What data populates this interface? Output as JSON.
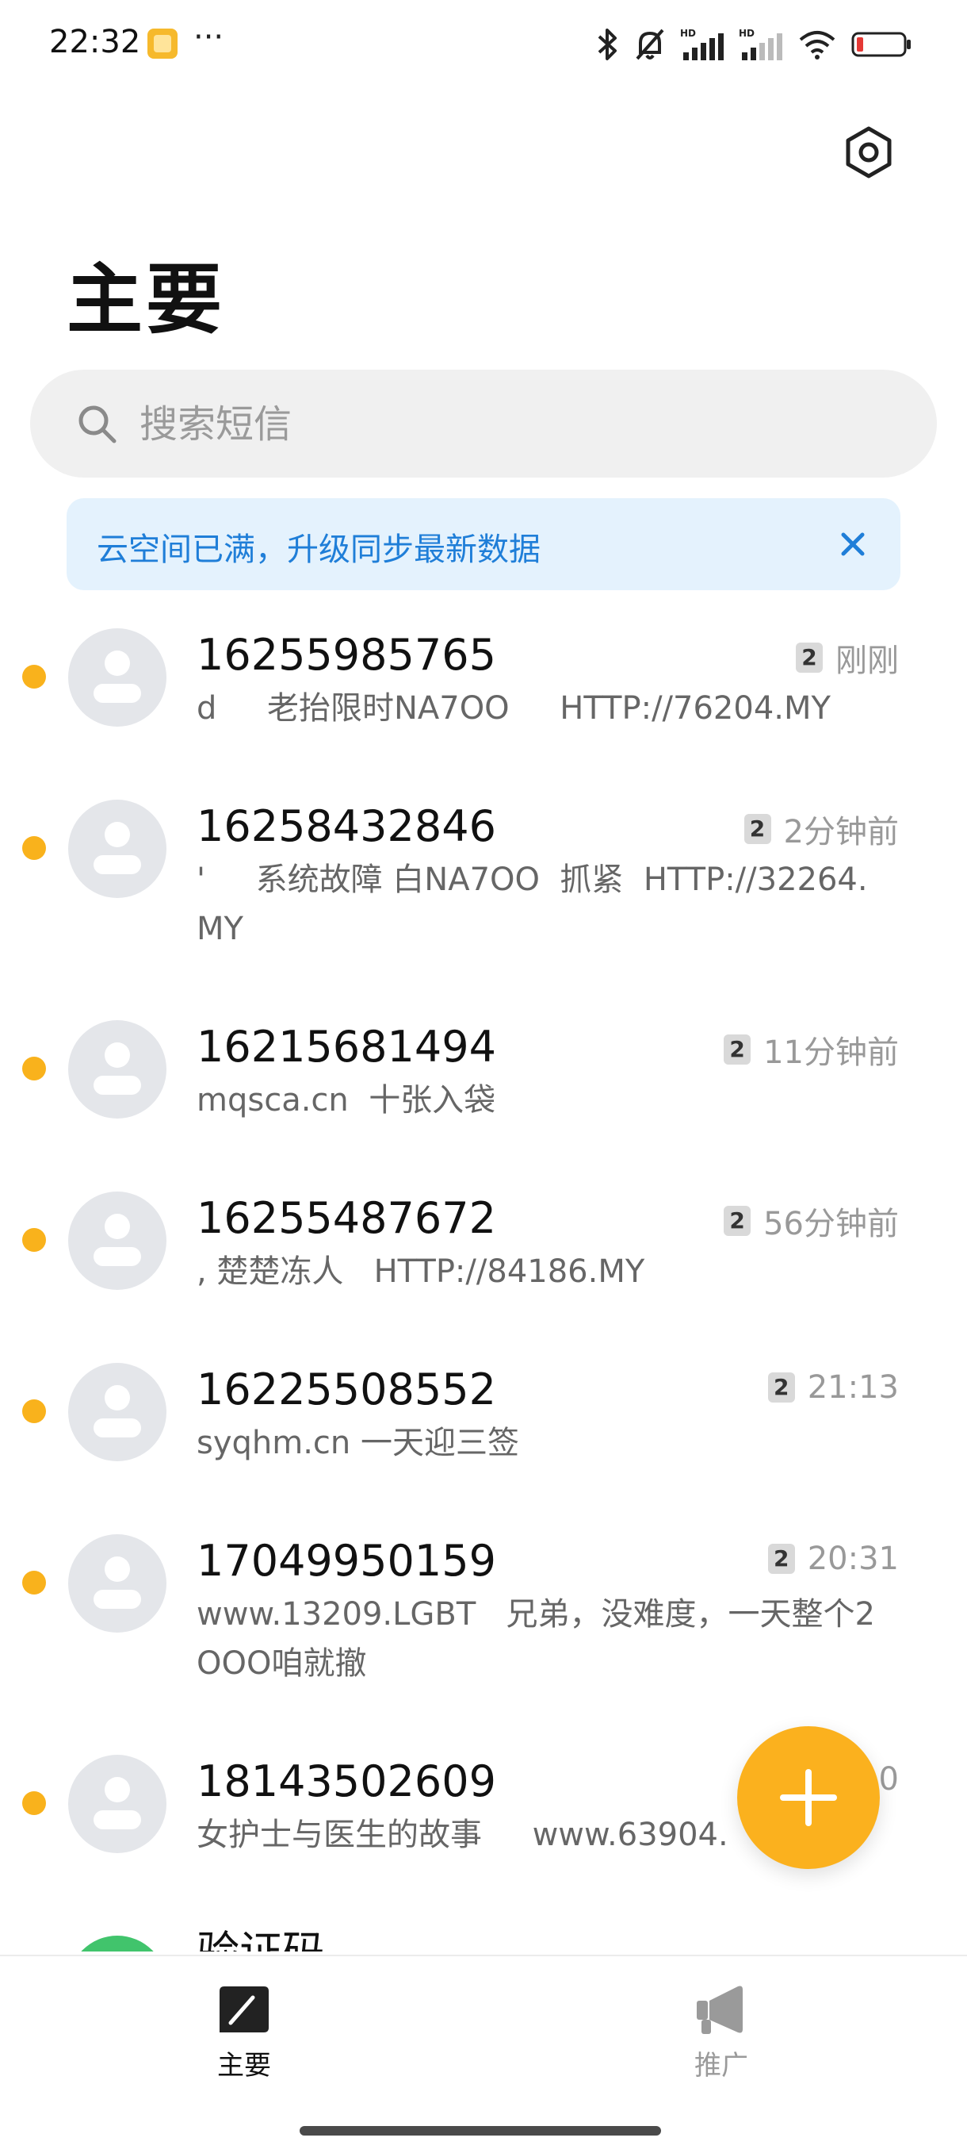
{
  "status_bar": {
    "time": "22:32",
    "more": "···"
  },
  "header": {
    "title": "主要"
  },
  "search": {
    "placeholder": "搜索短信"
  },
  "banner": {
    "text": "云空间已满，升级同步最新数据"
  },
  "messages": [
    {
      "sender": "16255985765",
      "preview": "d     老抬限时NA7OO     HTTP://76204.MY",
      "sim": "2",
      "time": "刚刚",
      "unread": true
    },
    {
      "sender": "16258432846",
      "preview": "'     系统故障 白NA7OO  抓紧  HTTP://32264.MY",
      "sim": "2",
      "time": "2分钟前",
      "unread": true
    },
    {
      "sender": "16215681494",
      "preview": "mqsca.cn  十张入袋",
      "sim": "2",
      "time": "11分钟前",
      "unread": true
    },
    {
      "sender": "16255487672",
      "preview": ", 楚楚冻人   HTTP://84186.MY",
      "sim": "2",
      "time": "56分钟前",
      "unread": true
    },
    {
      "sender": "16225508552",
      "preview": "syqhm.cn 一天迎三签",
      "sim": "2",
      "time": "21:13",
      "unread": true
    },
    {
      "sender": "17049950159",
      "preview": "www.13209.LGBT   兄弟，没难度，一天整个2OOO咱就撤",
      "sim": "2",
      "time": "20:31",
      "unread": true
    },
    {
      "sender": "18143502609",
      "preview": "女护士与医生的故事     www.63904.",
      "sim": "",
      "time": "0",
      "unread": true
    },
    {
      "sender": "验证码",
      "preview": "",
      "sim": "",
      "time": "",
      "unread": false
    }
  ],
  "bottom_nav": {
    "main_label": "主要",
    "promo_label": "推广"
  },
  "colors": {
    "accent": "#fbb11e",
    "unread_dot": "#f9b21c",
    "banner_bg": "#e4f2fd",
    "banner_text": "#1f7ed8"
  },
  "icons": {
    "settings": "gear-icon",
    "search": "search-icon",
    "close": "close-icon",
    "compose_fab": "plus-icon",
    "nav_main": "compose-icon",
    "nav_promo": "megaphone-icon"
  }
}
